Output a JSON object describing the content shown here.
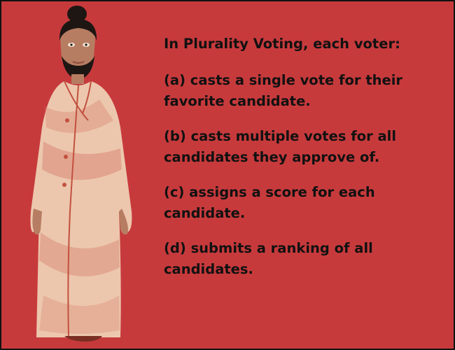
{
  "question": {
    "title": "In Plurality Voting, each voter:",
    "options": [
      "(a) casts a single vote for their favorite candidate.",
      "(b) casts multiple votes for all candidates they approve of.",
      "(c) assigns a score for each candidate.",
      "(d) submits a ranking of all candidates."
    ]
  },
  "illustration": {
    "name": "man-in-robe-illustration",
    "colors": {
      "background": "#c73a3c",
      "robe": "#ecc7ad",
      "robe_stain": "#d77a6a",
      "skin": "#b77d62",
      "hair": "#1d1613"
    }
  }
}
